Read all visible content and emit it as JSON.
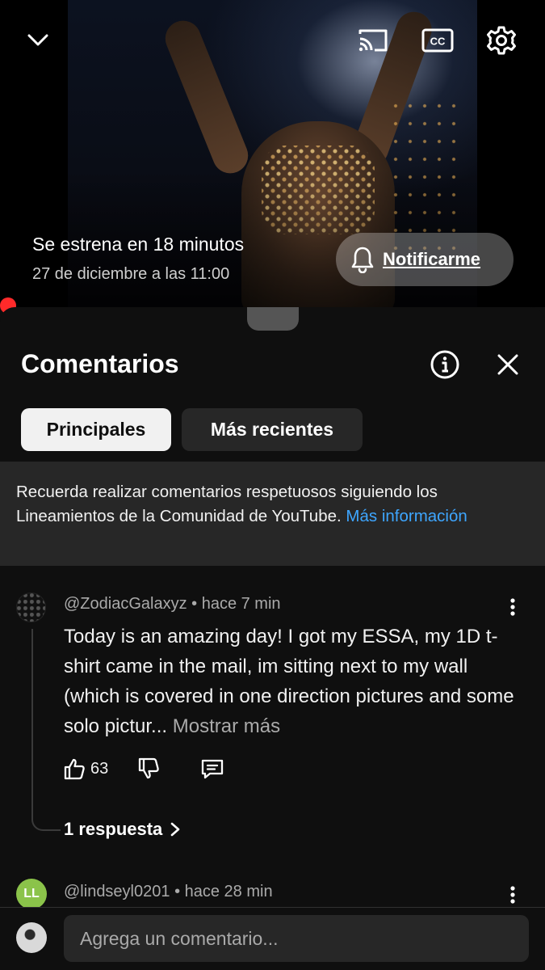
{
  "video": {
    "premiere_title": "Se estrena en 18 minutos",
    "premiere_date": "27 de diciembre a las 11:00",
    "notify_label": "Notificarme",
    "icons": [
      "chevron-down-icon",
      "cast-icon",
      "cc-icon",
      "gear-icon",
      "bell-icon"
    ]
  },
  "comments_panel": {
    "title": "Comentarios",
    "tabs": [
      {
        "label": "Principales",
        "active": true
      },
      {
        "label": "Más recientes",
        "active": false
      }
    ],
    "notice_text": "Recuerda realizar comentarios respetuosos siguiendo los Lineamientos de la Comunidad de YouTube.",
    "notice_link": "Más información",
    "comments": [
      {
        "author": "@ZodiacGalaxyz",
        "time": "hace 7 min",
        "text": "Today is an amazing day! I got my ESSA, my 1D t-shirt came in the mail, im sitting next to my wall (which is covered in one direction pictures and some solo pictur...",
        "show_more": "Mostrar más",
        "likes": "63",
        "replies_label": "1 respuesta"
      },
      {
        "author": "@lindseyl0201",
        "time": "hace 28 min",
        "avatar_initials": "LL"
      }
    ],
    "compose_placeholder": "Agrega un comentario...",
    "colors": {
      "background": "#0f0f0f",
      "chip_active": "#f1f1f1",
      "chip_inactive": "#272727",
      "link": "#3ea6ff",
      "live_dot": "#ff2a2a"
    }
  }
}
